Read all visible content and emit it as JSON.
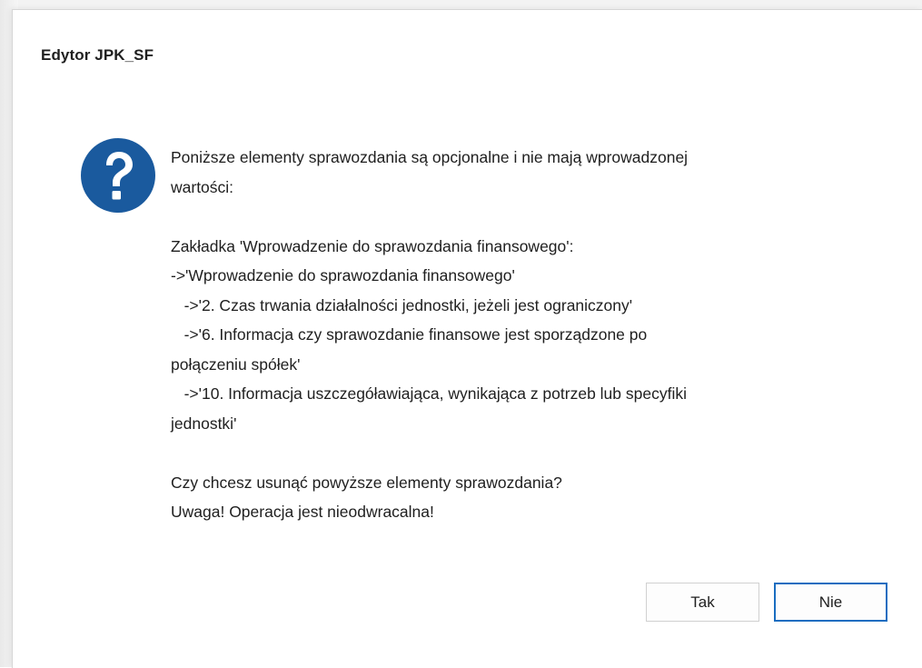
{
  "dialog": {
    "title": "Edytor JPK_SF",
    "icon": "question-icon",
    "message_lines": [
      "Poniższe elementy sprawozdania są opcjonalne i nie mają wprowadzonej",
      "wartości:",
      "",
      "Zakładka 'Wprowadzenie do sprawozdania finansowego':",
      "->'Wprowadzenie do sprawozdania finansowego'",
      "   ->'2. Czas trwania działalności jednostki, jeżeli jest ograniczony'",
      "   ->'6. Informacja czy sprawozdanie finansowe jest sporządzone po",
      "połączeniu spółek'",
      "   ->'10. Informacja uszczegóławiająca, wynikająca z potrzeb lub specyfiki",
      "jednostki'",
      "",
      "Czy chcesz usunąć powyższe elementy sprawozdania?",
      "Uwaga! Operacja jest nieodwracalna!"
    ],
    "buttons": {
      "yes_label": "Tak",
      "no_label": "Nie"
    },
    "colors": {
      "icon_background": "#1a5a9e",
      "default_button_border": "#1a6dc0"
    }
  }
}
